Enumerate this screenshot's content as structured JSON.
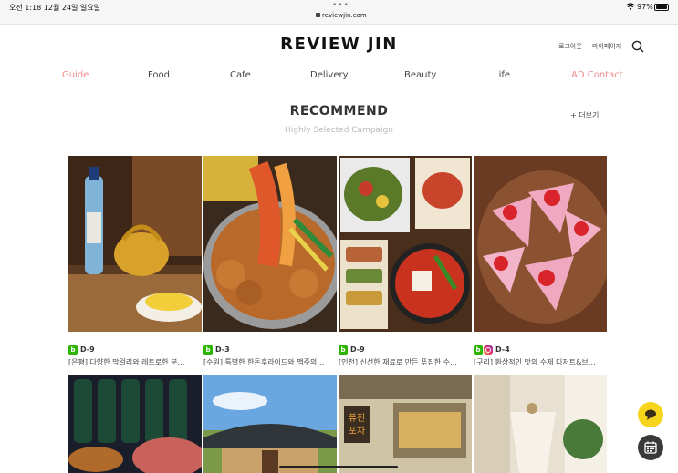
{
  "status_bar": {
    "time_date": "오전 1:18   12월 24일 일요일",
    "url": "reviewjin.com",
    "battery_text": "97%",
    "battery_level": 0.97
  },
  "header": {
    "logo": "REVIEW JIN",
    "logout": "로그아웃",
    "mypage": "마이페이지"
  },
  "nav": {
    "items": [
      {
        "label": "Guide",
        "accent": true
      },
      {
        "label": "Food",
        "accent": false
      },
      {
        "label": "Cafe",
        "accent": false
      },
      {
        "label": "Delivery",
        "accent": false
      },
      {
        "label": "Beauty",
        "accent": false
      },
      {
        "label": "Life",
        "accent": false
      },
      {
        "label": "AD Contact",
        "accent": true
      }
    ],
    "accent_color": "#ee8a8a"
  },
  "recommend": {
    "title": "RECOMMEND",
    "subtitle": "Highly Selected Campaign",
    "more": "+ 더보기"
  },
  "cards": [
    {
      "dday": "D-9",
      "text": "[은평] 다양한 막걸리와 레트로한 분…",
      "blog": true,
      "instagram": false
    },
    {
      "dday": "D-3",
      "text": "[수원] 특별한 한돈후라이드와 맥주의…",
      "blog": true,
      "instagram": false
    },
    {
      "dday": "D-9",
      "text": "[인천] 신선한 재료로 만든 푸짐한 수…",
      "blog": true,
      "instagram": false
    },
    {
      "dday": "D-4",
      "text": "[구리] 환상적인 맛의 수제 디저트&브…",
      "blog": true,
      "instagram": true
    }
  ],
  "row2_sign": "퓨전\n포차",
  "icons": {
    "search": "search-icon",
    "chat": "chat-bubble-icon",
    "calendar": "calendar-icon",
    "wifi": "wifi-icon",
    "battery": "battery-icon",
    "blog": "naver-blog-icon",
    "instagram": "instagram-icon"
  }
}
